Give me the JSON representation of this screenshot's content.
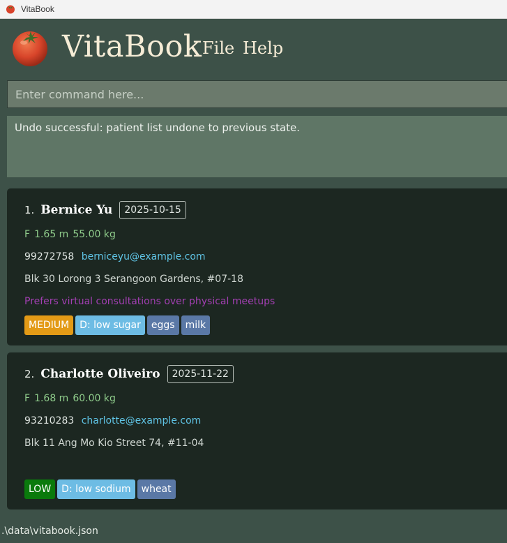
{
  "window": {
    "title": "VitaBook"
  },
  "header": {
    "brand": "VitaBook",
    "menu": [
      {
        "label": "File"
      },
      {
        "label": "Help"
      }
    ]
  },
  "command": {
    "placeholder": "Enter command here...",
    "value": ""
  },
  "result": {
    "message": "Undo successful: patient list undone to previous state."
  },
  "patients": [
    {
      "index": "1.",
      "name": "Bernice Yu",
      "date": "2025-10-15",
      "gender": "F",
      "height": "1.65 m",
      "weight": "55.00 kg",
      "phone": "99272758",
      "email": "berniceyu@example.com",
      "address": "Blk 30 Lorong 3 Serangoon Gardens, #07-18",
      "note": "Prefers virtual consultations over physical meetups",
      "tags": [
        {
          "label": "MEDIUM",
          "kind": "priority-medium",
          "color": "#e39a16"
        },
        {
          "label": "D: low sugar",
          "kind": "diet",
          "color": "#6dbce4"
        },
        {
          "label": "eggs",
          "kind": "allergy",
          "color": "#5a78a6"
        },
        {
          "label": "milk",
          "kind": "allergy",
          "color": "#5a78a6"
        }
      ]
    },
    {
      "index": "2.",
      "name": "Charlotte Oliveiro",
      "date": "2025-11-22",
      "gender": "F",
      "height": "1.68 m",
      "weight": "60.00 kg",
      "phone": "93210283",
      "email": "charlotte@example.com",
      "address": "Blk 11 Ang Mo Kio Street 74, #11-04",
      "note": "",
      "tags": [
        {
          "label": "LOW",
          "kind": "priority-low",
          "color": "#0a7a0c"
        },
        {
          "label": "D: low sodium",
          "kind": "diet",
          "color": "#6dbce4"
        },
        {
          "label": "wheat",
          "kind": "allergy",
          "color": "#5a78a6"
        }
      ]
    }
  ],
  "status": {
    "path": ".\\data\\vitabook.json"
  },
  "icons": {
    "app": "tomato-icon",
    "logo": "tomato-logo"
  }
}
